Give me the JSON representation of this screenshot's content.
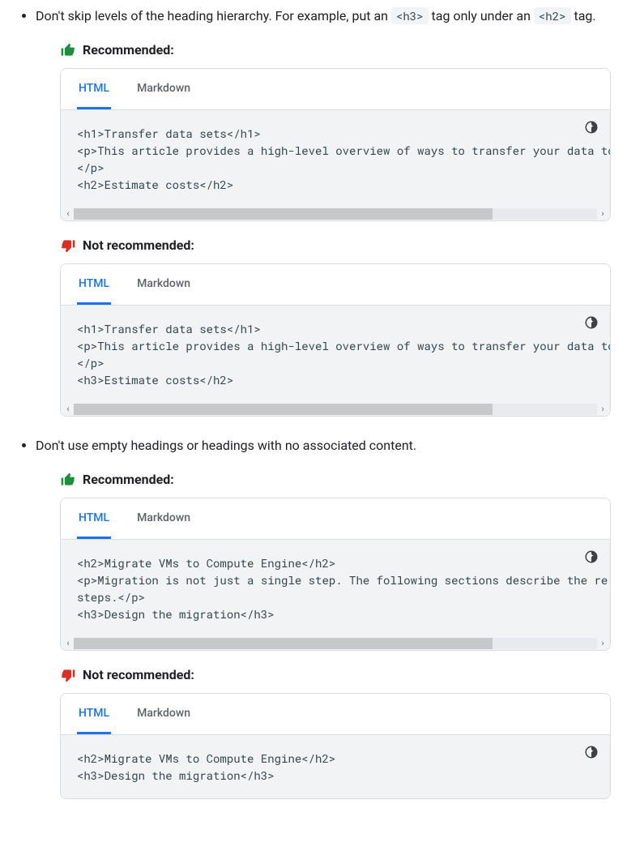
{
  "bullets": [
    {
      "text_pre": "Don't skip levels of the heading hierarchy. For example, put an ",
      "code1": "<h3>",
      "text_mid": " tag only under an ",
      "code2": "<h2>",
      "text_post": " tag."
    },
    {
      "text_full": "Don't use empty headings or headings with no associated content."
    }
  ],
  "labels": {
    "recommended": "Recommended:",
    "not_recommended": "Not recommended:"
  },
  "tabs": {
    "html": "HTML",
    "markdown": "Markdown"
  },
  "blocks": [
    {
      "has_scroll": true,
      "code": "<h1>Transfer data sets</h1>\n<p>This article provides a high-level overview of ways to transfer your data to\n</p>\n<h2>Estimate costs</h2>"
    },
    {
      "has_scroll": true,
      "code": "<h1>Transfer data sets</h1>\n<p>This article provides a high-level overview of ways to transfer your data to\n</p>\n<h3>Estimate costs</h2>"
    },
    {
      "has_scroll": true,
      "code": "<h2>Migrate VMs to Compute Engine</h2>\n<p>Migration is not just a single step. The following sections describe the re\nsteps.</p>\n<h3>Design the migration</h3>"
    },
    {
      "has_scroll": false,
      "code": "<h2>Migrate VMs to Compute Engine</h2>\n<h3>Design the migration</h3>"
    }
  ],
  "scroll_arrows": {
    "left": "‹",
    "right": "›"
  }
}
